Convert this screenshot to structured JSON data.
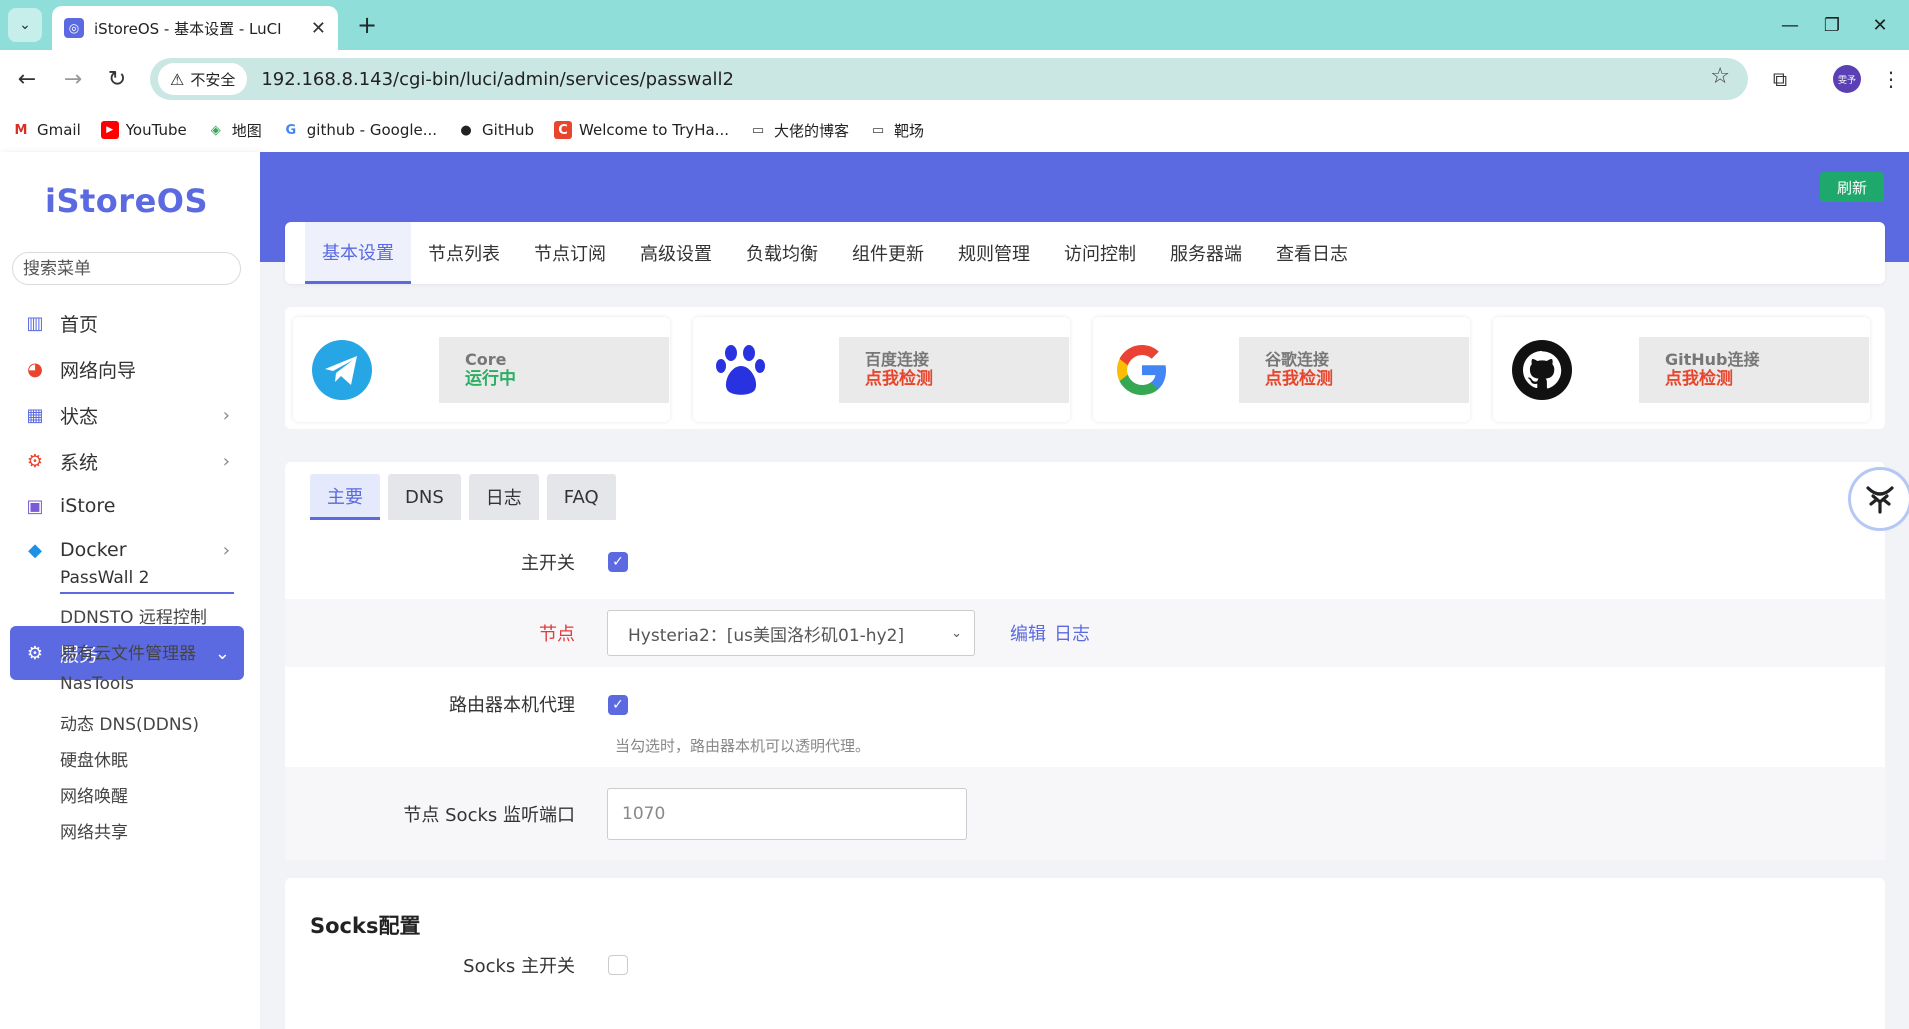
{
  "browser": {
    "tab_title": "iStoreOS - 基本设置 - LuCI",
    "security_label": "不安全",
    "url": "192.168.8.143/cgi-bin/luci/admin/services/passwall2",
    "profile_label": "雯予",
    "bookmarks": [
      {
        "label": "Gmail",
        "icon": "gmail-icon",
        "color": "#d93025"
      },
      {
        "label": "YouTube",
        "icon": "youtube-icon",
        "color": "#ff0000"
      },
      {
        "label": "地图",
        "icon": "maps-icon",
        "color": "#34a853"
      },
      {
        "label": "github - Google...",
        "icon": "google-icon",
        "color": "#4285f4"
      },
      {
        "label": "GitHub",
        "icon": "github-icon",
        "color": "#222222"
      },
      {
        "label": "Welcome to TryHa...",
        "icon": "tryhackme-icon",
        "color": "#e8452c"
      },
      {
        "label": "大佬的博客",
        "icon": "folder-icon",
        "color": "#444444"
      },
      {
        "label": "靶场",
        "icon": "folder-icon",
        "color": "#444444"
      }
    ]
  },
  "sidebar": {
    "logo": "iStoreOS",
    "search_placeholder": "搜索菜单",
    "items": [
      {
        "label": "首页",
        "icon": "dashboard-icon"
      },
      {
        "label": "网络向导",
        "icon": "network-wizard-icon"
      },
      {
        "label": "状态",
        "icon": "status-grid-icon"
      },
      {
        "label": "系统",
        "icon": "gear-icon"
      },
      {
        "label": "iStore",
        "icon": "store-icon"
      },
      {
        "label": "Docker",
        "icon": "docker-icon"
      },
      {
        "label": "服务",
        "icon": "services-icon"
      }
    ],
    "subitems": [
      "PassWall 2",
      "DDNSTO 远程控制",
      "易有云文件管理器",
      "NasTools",
      "动态 DNS(DDNS)",
      "硬盘休眠",
      "网络唤醒",
      "网络共享"
    ]
  },
  "header": {
    "refresh_label": "刷新"
  },
  "top_tabs": [
    "基本设置",
    "节点列表",
    "节点订阅",
    "高级设置",
    "负载均衡",
    "组件更新",
    "规则管理",
    "访问控制",
    "服务器端",
    "查看日志"
  ],
  "status_cards": [
    {
      "label": "Core",
      "status": "运行中",
      "status_color": "#2ab062",
      "icon": "telegram-icon"
    },
    {
      "label": "百度连接",
      "status": "点我检测",
      "status_color": "#e8452c",
      "icon": "baidu-paw-icon"
    },
    {
      "label": "谷歌连接",
      "status": "点我检测",
      "status_color": "#e8452c",
      "icon": "google-icon"
    },
    {
      "label": "GitHub连接",
      "status": "点我检测",
      "status_color": "#e8452c",
      "icon": "github-icon"
    }
  ],
  "sub_tabs": [
    "主要",
    "DNS",
    "日志",
    "FAQ"
  ],
  "form": {
    "main_switch_label": "主开关",
    "node_label": "节点",
    "node_value": "Hysteria2：[us美国洛杉矶01-hy2]",
    "edit_link": "编辑",
    "log_link": "日志",
    "router_proxy_label": "路由器本机代理",
    "router_proxy_hint": "当勾选时，路由器本机可以透明代理。",
    "socks_port_label": "节点 Socks 监听端口",
    "socks_port_placeholder": "1070"
  },
  "socks": {
    "title": "Socks配置",
    "switch_label": "Socks 主开关"
  },
  "colors": {
    "accent": "#5b6ae0",
    "chrome": "#8fded9",
    "refresh": "#1fa86c"
  }
}
